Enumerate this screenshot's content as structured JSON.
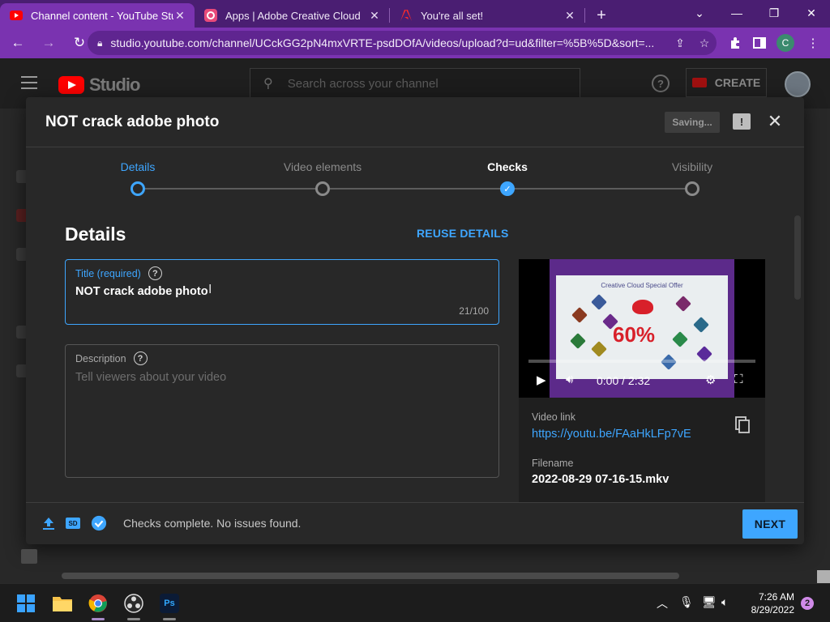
{
  "browser": {
    "tabs": [
      {
        "title": "Channel content - YouTube Studio",
        "favicon": "youtube-icon",
        "active": true
      },
      {
        "title": "Apps | Adobe Creative Cloud",
        "favicon": "adobe-cc-icon",
        "active": false
      },
      {
        "title": "You're all set!",
        "favicon": "adobe-icon",
        "active": false
      }
    ],
    "url": "studio.youtube.com/channel/UCckGG2pN4mxVRTE-psdDOfA/videos/upload?d=ud&filter=%5B%5D&sort=...",
    "profile_initial": "C",
    "accent": "#7a33b0"
  },
  "studio": {
    "logo_text": "Studio",
    "search_placeholder": "Search across your channel",
    "create_label": "CREATE"
  },
  "dialog": {
    "title": "NOT crack adobe photo",
    "saving_label": "Saving...",
    "steps": [
      {
        "label": "Details",
        "state": "active"
      },
      {
        "label": "Video elements",
        "state": "pending"
      },
      {
        "label": "Checks",
        "state": "complete"
      },
      {
        "label": "Visibility",
        "state": "pending"
      }
    ],
    "section_title": "Details",
    "reuse_label": "REUSE DETAILS",
    "title_field": {
      "label": "Title (required)",
      "value": "NOT crack adobe photo",
      "count": "21/100"
    },
    "description_field": {
      "label": "Description",
      "placeholder": "Tell viewers about your video"
    },
    "video": {
      "thumbnail_heading": "Creative Cloud Special Offer",
      "thumbnail_percent": "60%",
      "time": "0:00 / 2:32",
      "progress": 0,
      "link_label": "Video link",
      "link": "https://youtu.be/FAaHkLFp7vE",
      "filename_label": "Filename",
      "filename": "2022-08-29 07-16-15.mkv"
    },
    "footer": {
      "status": "Checks complete. No issues found.",
      "sd_label": "SD",
      "next_label": "NEXT"
    },
    "accent": "#3ea6ff"
  },
  "taskbar": {
    "time": "7:26 AM",
    "date": "8/29/2022",
    "notifications": "2",
    "photoshop_label": "Ps"
  }
}
